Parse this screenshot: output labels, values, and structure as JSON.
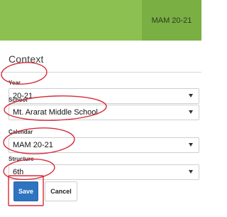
{
  "header": {
    "tab_label": "MAM 20-21"
  },
  "context": {
    "title": "Context"
  },
  "fields": {
    "year": {
      "label": "Year",
      "value": "20-21"
    },
    "school": {
      "label": "School",
      "value": "Mt. Ararat Middle School"
    },
    "calendar": {
      "label": "Calendar",
      "value": "MAM 20-21"
    },
    "structure": {
      "label": "Structure",
      "value": "6th"
    }
  },
  "buttons": {
    "save": "Save",
    "cancel": "Cancel"
  },
  "annotation": {
    "color": "#d62b3a"
  }
}
